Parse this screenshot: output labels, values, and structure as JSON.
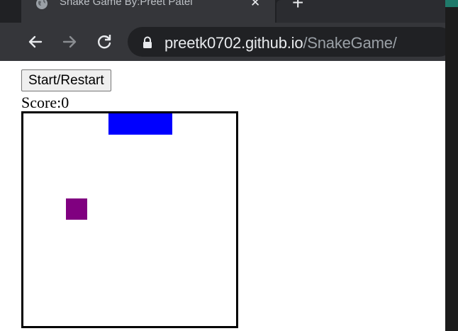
{
  "browser": {
    "tab": {
      "title": "Snake Game By:Preet Patel",
      "close_label": "✕"
    },
    "new_tab_label": "+",
    "url": {
      "host": "preetk0702.github.io",
      "path": "/SnakeGame/"
    }
  },
  "page": {
    "start_button_label": "Start/Restart",
    "score_text": "Score:0"
  },
  "game": {
    "colors": {
      "snake": "#0000ff",
      "food": "#800080",
      "board_border": "#000000"
    },
    "grid_cells": 10,
    "snake": [
      [
        4,
        0
      ],
      [
        5,
        0
      ],
      [
        6,
        0
      ]
    ],
    "food": [
      2,
      4
    ]
  }
}
